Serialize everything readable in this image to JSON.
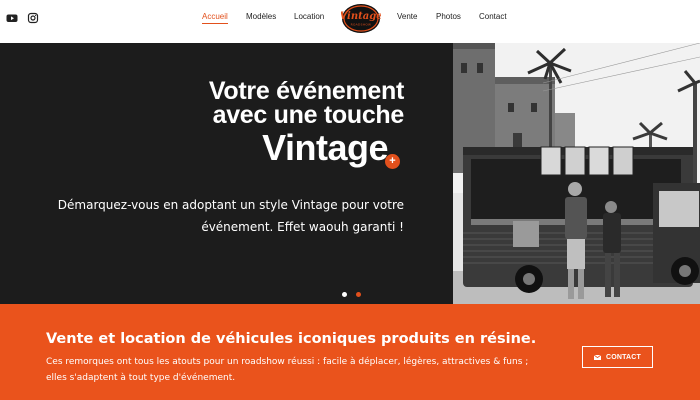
{
  "social": [
    {
      "icon": "youtube-icon"
    },
    {
      "icon": "instagram-icon"
    }
  ],
  "nav": {
    "items": [
      {
        "label": "Accueil",
        "active": true
      },
      {
        "label": "Modèles",
        "active": false
      },
      {
        "label": "Location",
        "active": false
      },
      {
        "label": "Vente",
        "active": false
      },
      {
        "label": "Photos",
        "active": false
      },
      {
        "label": "Contact",
        "active": false
      }
    ],
    "logo": {
      "text": "Vintage",
      "sub": "ROADSHOW"
    }
  },
  "hero": {
    "title_line1": "Votre événement",
    "title_line2": "avec une touche",
    "title_line3": "Vintage",
    "plus": "+",
    "subtitle": "Démarquez-vous en adoptant un style Vintage pour votre événement. Effet waouh garanti !",
    "slides": {
      "count": 2,
      "active": 2
    }
  },
  "band": {
    "title": "Vente et location de véhicules iconiques produits en résine.",
    "text": "Ces remorques ont tous les atouts pour un roadshow réussi : facile à déplacer, légères, attractives & funs ; elles s'adaptent à tout type d'événement.",
    "button_label": "CONTACT"
  },
  "colors": {
    "accent": "#e2501c",
    "band": "#ea531c",
    "hero_bg": "#1c1c1c"
  }
}
